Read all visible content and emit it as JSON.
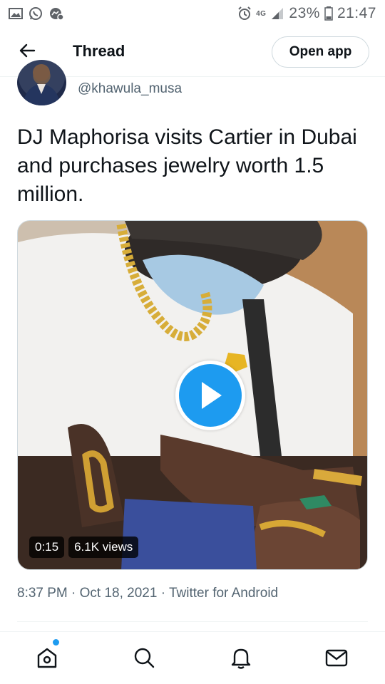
{
  "status_bar": {
    "battery": "23%",
    "time": "21:47",
    "network": "4G",
    "icons": [
      "gallery-icon",
      "whatsapp-icon",
      "messenger-icon",
      "alarm-icon",
      "signal-icon",
      "battery-icon"
    ]
  },
  "header": {
    "title": "Thread",
    "open_app_label": "Open app",
    "back_icon": "arrow-left-icon"
  },
  "tweet": {
    "handle": "@khawula_musa",
    "text": "DJ Maphorisa visits Cartier in Dubai and purchases jewelry worth 1.5 million.",
    "media": {
      "duration": "0:15",
      "views": "6.1K views"
    },
    "meta": "8:37 PM · Oct 18, 2021 · Twitter for Android"
  },
  "bottom_nav": {
    "items": [
      "home-icon",
      "search-icon",
      "notifications-icon",
      "messages-icon"
    ]
  },
  "colors": {
    "accent": "#1d9bf0",
    "text_primary": "#0f1419",
    "text_secondary": "#536471",
    "border": "#cfd9de"
  }
}
